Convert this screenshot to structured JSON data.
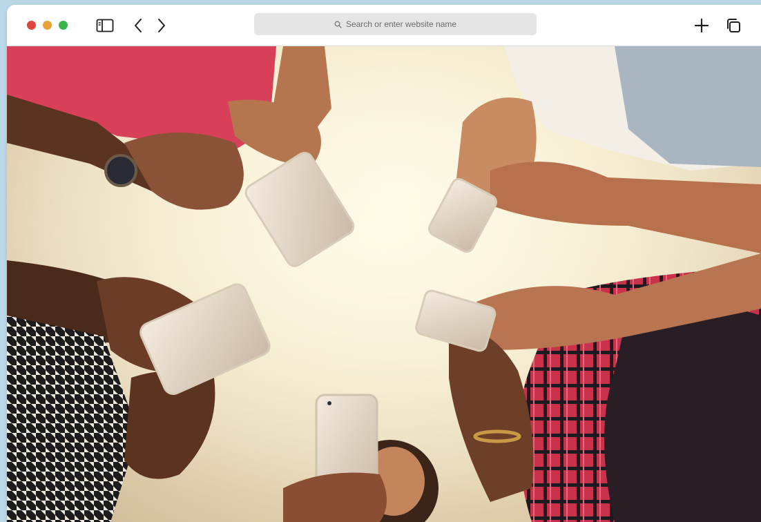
{
  "browser": {
    "address_bar": {
      "placeholder": "Search or enter website name"
    },
    "icons": [
      "close-dot",
      "minimize-dot",
      "zoom-dot",
      "sidebar-icon",
      "back-icon",
      "forward-icon",
      "search-icon",
      "new-tab-icon",
      "tabs-overview-icon"
    ]
  },
  "photo": {
    "subject": "Group of people holding smartphones, viewed from below",
    "colors": {
      "sky": "#f3e8c8",
      "red_shirt": "#d8405a",
      "skin_dark": "#5a3321",
      "skin_medium": "#b5764f",
      "phone": "#e9dccd"
    }
  }
}
